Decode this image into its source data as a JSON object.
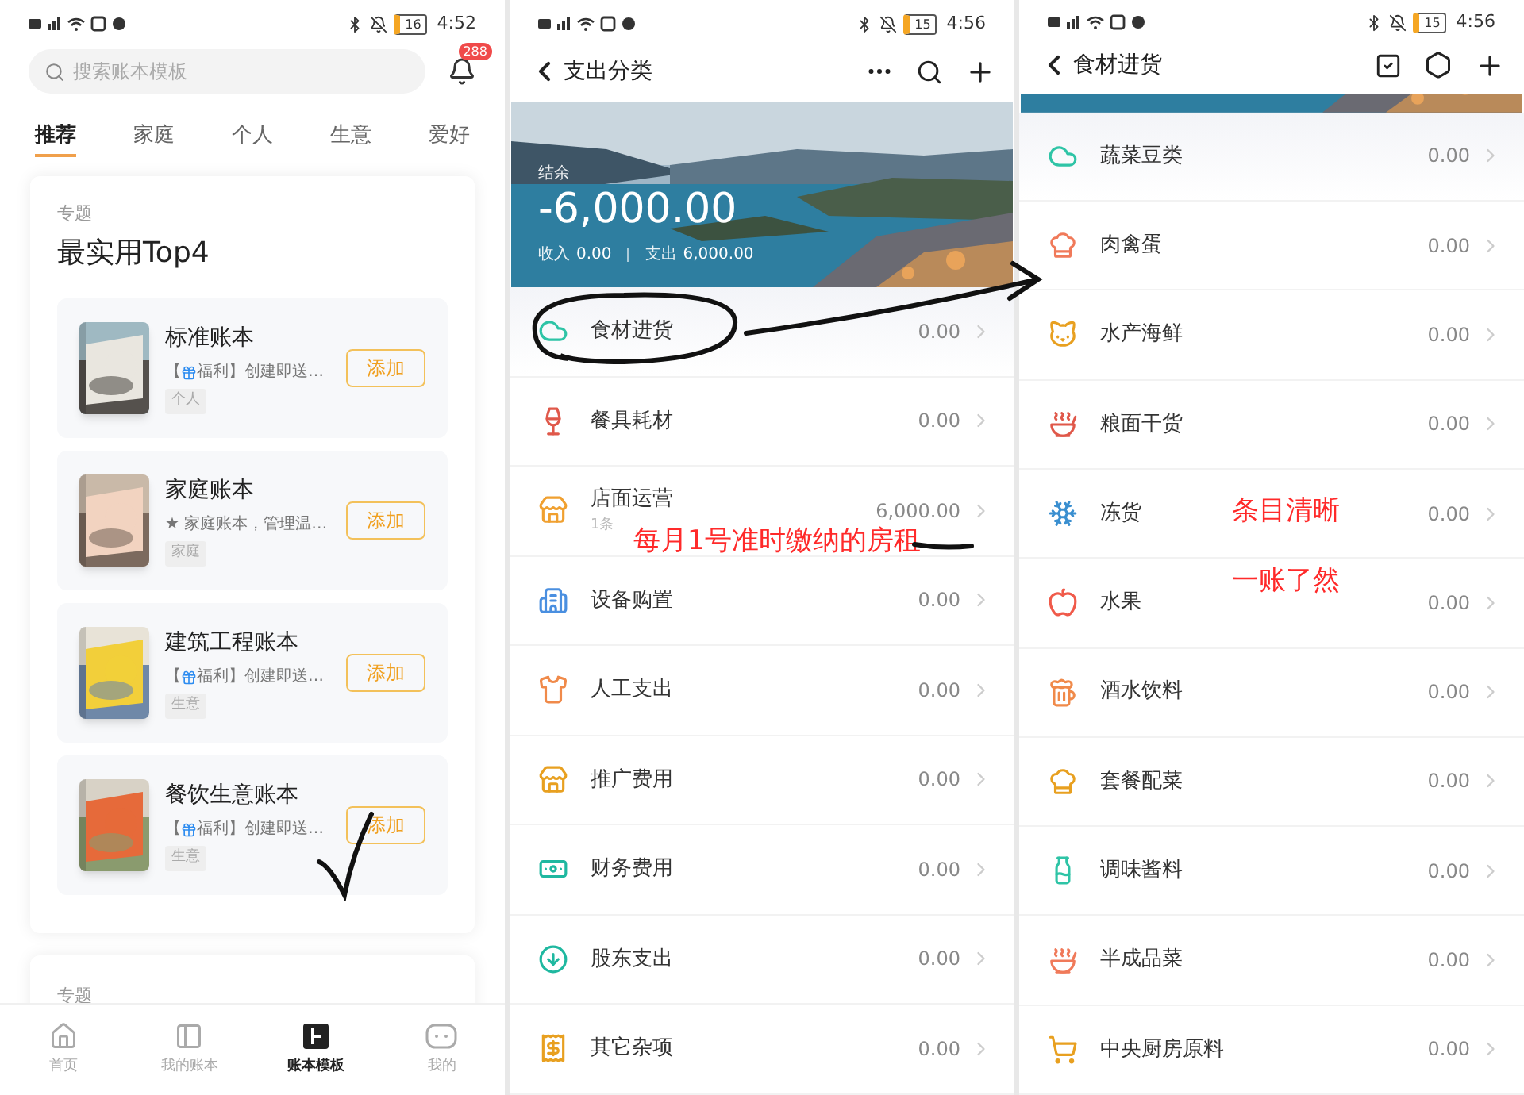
{
  "template_screen": {
    "status_bar": {
      "time": "4:52",
      "battery": "16"
    },
    "search": {
      "placeholder": "搜索账本模板"
    },
    "notification_badge": "288",
    "tabs": [
      {
        "label": "推荐",
        "selected": true
      },
      {
        "label": "家庭",
        "selected": false
      },
      {
        "label": "个人",
        "selected": false
      },
      {
        "label": "生意",
        "selected": false
      },
      {
        "label": "爱好",
        "selected": false
      }
    ],
    "featured": {
      "heading": "专题",
      "title": "最实用Top4",
      "templates": [
        {
          "title": "标准账本",
          "description": {
            "kind": "promo",
            "prefix": "【",
            "text": "福利】创建即送…"
          },
          "tag": "个人",
          "button": "添加"
        },
        {
          "title": "家庭账本",
          "description": {
            "kind": "plain",
            "text": "★ 家庭账本，管理温…"
          },
          "tag": "家庭",
          "button": "添加"
        },
        {
          "title": "建筑工程账本",
          "description": {
            "kind": "promo",
            "prefix": "【",
            "text": "福利】创建即送…"
          },
          "tag": "生意",
          "button": "添加"
        },
        {
          "title": "餐饮生意账本",
          "description": {
            "kind": "promo",
            "prefix": "【",
            "text": "福利】创建即送…"
          },
          "tag": "生意",
          "button": "添加"
        }
      ]
    },
    "next_section": {
      "heading": "专题"
    },
    "bottom_nav": [
      {
        "label": "首页",
        "selected": false
      },
      {
        "label": "我的账本",
        "selected": false
      },
      {
        "label": "账本模板",
        "selected": true
      },
      {
        "label": "我的",
        "selected": false
      }
    ]
  },
  "expense_screen": {
    "status_bar": {
      "time": "4:56",
      "battery": "15"
    },
    "header": {
      "title": "支出分类"
    },
    "banner": {
      "balance_label": "结余",
      "balance": "-6,000.00",
      "income_label": "收入",
      "income": "0.00",
      "expense_label": "支出",
      "expense": "6,000.00"
    },
    "categories": [
      {
        "name": "食材进货",
        "amount": "0.00",
        "selected": true
      },
      {
        "name": "餐具耗材",
        "amount": "0.00",
        "selected": false
      },
      {
        "name": "店面运营",
        "amount": "6,000.00",
        "subtitle": "1条",
        "selected": false
      },
      {
        "name": "设备购置",
        "amount": "0.00",
        "selected": false
      },
      {
        "name": "人工支出",
        "amount": "0.00",
        "selected": false
      },
      {
        "name": "推广费用",
        "amount": "0.00",
        "selected": false
      },
      {
        "name": "财务费用",
        "amount": "0.00",
        "selected": false
      },
      {
        "name": "股东支出",
        "amount": "0.00",
        "selected": false
      },
      {
        "name": "其它杂项",
        "amount": "0.00",
        "selected": false
      }
    ],
    "annotation": "每月1号准时缴纳的房租"
  },
  "ingredient_screen": {
    "status_bar": {
      "time": "4:56",
      "battery": "15"
    },
    "header": {
      "title": "食材进货"
    },
    "items": [
      {
        "name": "蔬菜豆类",
        "amount": "0.00",
        "selected": true
      },
      {
        "name": "肉禽蛋",
        "amount": "0.00",
        "selected": false
      },
      {
        "name": "水产海鲜",
        "amount": "0.00",
        "selected": false
      },
      {
        "name": "粮面干货",
        "amount": "0.00",
        "selected": false
      },
      {
        "name": "冻货",
        "amount": "0.00",
        "selected": false
      },
      {
        "name": "水果",
        "amount": "0.00",
        "selected": false
      },
      {
        "name": "酒水饮料",
        "amount": "0.00",
        "selected": false
      },
      {
        "name": "套餐配菜",
        "amount": "0.00",
        "selected": false
      },
      {
        "name": "调味酱料",
        "amount": "0.00",
        "selected": false
      },
      {
        "name": "半成品菜",
        "amount": "0.00",
        "selected": false
      },
      {
        "name": "中央厨房原料",
        "amount": "0.00",
        "selected": false
      }
    ],
    "annotation": [
      "条目清晰",
      "一账了然"
    ]
  }
}
